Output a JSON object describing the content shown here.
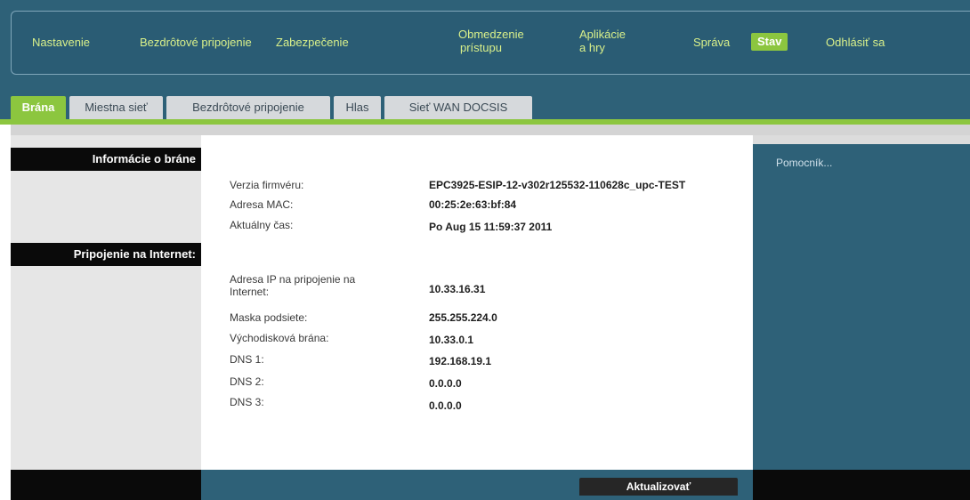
{
  "nav": {
    "items": [
      {
        "label": "Nastavenie"
      },
      {
        "label": "Bezdrôtové pripojenie"
      },
      {
        "label": "Zabezpečenie"
      },
      {
        "label": "Obmedzenie",
        "label2": "prístupu"
      },
      {
        "label": "Aplikácie",
        "label2": "a hry"
      },
      {
        "label": "Správa"
      },
      {
        "label": "Stav"
      },
      {
        "label": "Odhlásiť sa"
      }
    ]
  },
  "tabs": [
    {
      "label": "Brána"
    },
    {
      "label": "Miestna sieť"
    },
    {
      "label": "Bezdrôtové pripojenie"
    },
    {
      "label": "Hlas"
    },
    {
      "label": "Sieť WAN DOCSIS"
    }
  ],
  "sections": {
    "gateway_info": "Informácie o bráne",
    "internet": "Pripojenie na Internet:"
  },
  "gateway": {
    "firmware_label": "Verzia firmvéru:",
    "firmware_value": "EPC3925-ESIP-12-v302r125532-110628c_upc-TEST",
    "mac_label": "Adresa MAC:",
    "mac_value": "00:25:2e:63:bf:84",
    "time_label": "Aktuálny čas:",
    "time_value": "Po Aug 15 11:59:37 2011"
  },
  "internet": {
    "ip_label1": "Adresa IP na pripojenie na",
    "ip_label2": "Internet:",
    "ip_value": "10.33.16.31",
    "mask_label": "Maska podsiete:",
    "mask_value": "255.255.224.0",
    "gateway_label": "Východisková brána:",
    "gateway_value": "10.33.0.1",
    "dns1_label": "DNS 1:",
    "dns1_value": "192.168.19.1",
    "dns2_label": "DNS 2:",
    "dns2_value": "0.0.0.0",
    "dns3_label": "DNS 3:",
    "dns3_value": "0.0.0.0"
  },
  "help": {
    "label": "Pomocník..."
  },
  "footer": {
    "refresh_label": "Aktualizovať"
  },
  "colors": {
    "accent": "#8cc63f",
    "header_bg": "#2e6178",
    "nav_text": "#d9f08a"
  }
}
